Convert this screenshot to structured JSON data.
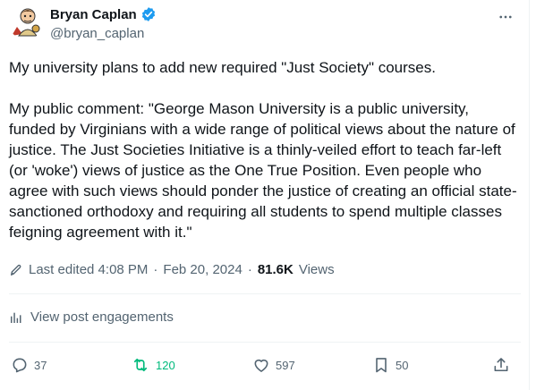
{
  "author": {
    "name": "Bryan Caplan",
    "handle": "@bryan_caplan",
    "verified_color": "#1d9bf0"
  },
  "tweet": {
    "text": "My university plans to add new required \"Just Society\" courses.\n\nMy public comment: \"George Mason University is a public university, funded by Virginians with a wide range of political views about the nature of justice. The Just Societies Initiative is a thinly-veiled effort to teach far-left (or 'woke') views of justice as the One True Position. Even people who agree with such views should ponder the justice of creating an official state-sanctioned orthodoxy and requiring all students to spend multiple classes feigning agreement with it.\"",
    "edited_label": "Last edited 4:08 PM",
    "date": "Feb 20, 2024",
    "views_count": "81.6K",
    "views_label": "Views",
    "separator": "·"
  },
  "engagements_label": "View post engagements",
  "actions": {
    "replies": "37",
    "reposts": "120",
    "likes": "597",
    "bookmarks": "50"
  },
  "colors": {
    "repost": "#00ba7c",
    "muted": "#536471",
    "text": "#0f1419"
  },
  "icons": [
    "avatar",
    "verified-badge-icon",
    "more-icon",
    "edit-icon",
    "analytics-icon",
    "reply-icon",
    "repost-icon",
    "like-icon",
    "bookmark-icon",
    "share-icon"
  ]
}
